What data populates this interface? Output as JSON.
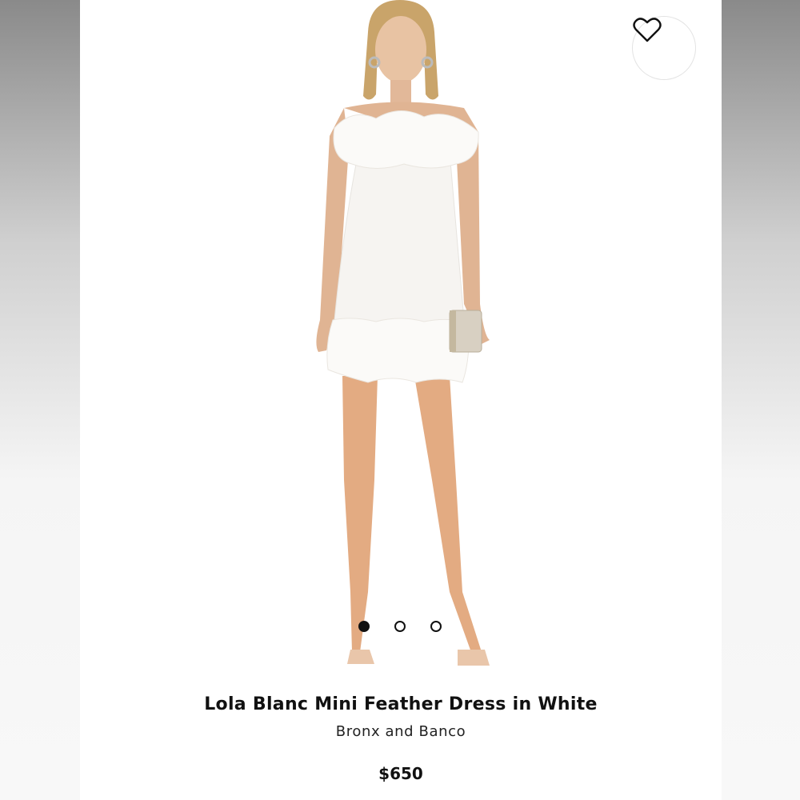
{
  "product": {
    "title": "Lola Blanc Mini Feather Dress in White",
    "brand": "Bronx and Banco",
    "price": "$650"
  },
  "gallery": {
    "slide_count": 3,
    "active_index": 0
  },
  "icons": {
    "favorite": "heart-outline-icon"
  },
  "colors": {
    "text": "#111111",
    "background": "#ffffff"
  }
}
